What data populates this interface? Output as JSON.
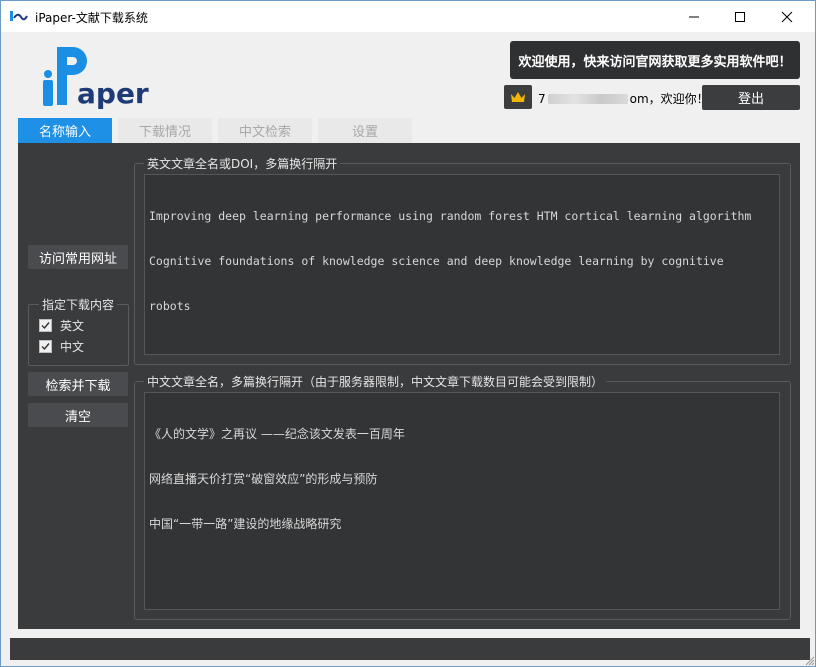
{
  "window": {
    "title": "iPaper-文献下载系统"
  },
  "header": {
    "logo_text": "iPaper",
    "promo_text": "欢迎使用，快来访问官网获取更多实用软件吧！",
    "user_prefix": "7",
    "user_suffix": "om，欢迎你！",
    "logout_label": "登出"
  },
  "tabs": [
    {
      "label": "名称输入",
      "active": true
    },
    {
      "label": "下载情况",
      "active": false
    },
    {
      "label": "中文检索",
      "active": false
    },
    {
      "label": "设置",
      "active": false
    }
  ],
  "sidebar": {
    "visit_button": "访问常用网址",
    "download_group": {
      "title": "指定下载内容",
      "options": [
        {
          "label": "英文",
          "checked": true
        },
        {
          "label": "中文",
          "checked": true
        }
      ]
    },
    "search_download_button": "检索并下载",
    "clear_button": "清空"
  },
  "english_section": {
    "legend": "英文文章全名或DOI，多篇换行隔开",
    "lines": [
      "Improving deep learning performance using random forest HTM cortical learning algorithm",
      "Cognitive foundations of knowledge science and deep knowledge learning by cognitive",
      "robots"
    ]
  },
  "chinese_section": {
    "legend": "中文文章全名，多篇换行隔开（由于服务器限制，中文文章下载数目可能会受到限制）",
    "lines": [
      "《人的文学》之再议 ——纪念该文发表一百周年",
      "网络直播天价打赏“破窗效应”的形成与预防",
      "中国“一带一路”建设的地缘战略研究"
    ]
  },
  "colors": {
    "accent": "#1e90e6",
    "panel": "#3a3b3d",
    "button": "#4a4b4e",
    "logo_blue": "#1a8fe3",
    "logo_navy": "#1f3b77",
    "crown": "#f2b705"
  }
}
